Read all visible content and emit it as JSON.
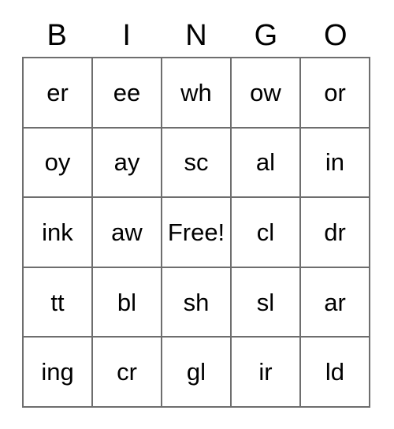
{
  "card": {
    "title_letters": [
      "B",
      "I",
      "N",
      "G",
      "O"
    ],
    "free_space_label": "Free!",
    "colors": {
      "grid_line": "#6e6e6e",
      "text": "#000000",
      "background": "#ffffff"
    },
    "columns": 5,
    "rows": 5,
    "cells": [
      [
        {
          "label": "er"
        },
        {
          "label": "ee"
        },
        {
          "label": "wh"
        },
        {
          "label": "ow"
        },
        {
          "label": "or"
        }
      ],
      [
        {
          "label": "oy"
        },
        {
          "label": "ay"
        },
        {
          "label": "sc"
        },
        {
          "label": "al"
        },
        {
          "label": "in"
        }
      ],
      [
        {
          "label": "ink"
        },
        {
          "label": "aw"
        },
        {
          "label": "Free!"
        },
        {
          "label": "cl"
        },
        {
          "label": "dr"
        }
      ],
      [
        {
          "label": "tt"
        },
        {
          "label": "bl"
        },
        {
          "label": "sh"
        },
        {
          "label": "sl"
        },
        {
          "label": "ar"
        }
      ],
      [
        {
          "label": "ing"
        },
        {
          "label": "cr"
        },
        {
          "label": "gl"
        },
        {
          "label": "ir"
        },
        {
          "label": "ld"
        }
      ]
    ]
  }
}
